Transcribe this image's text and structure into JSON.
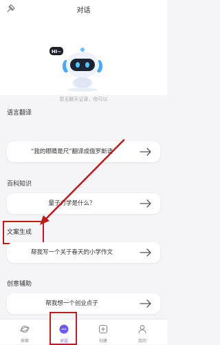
{
  "header": {
    "title": "对话"
  },
  "hero": {
    "badge": "HI~",
    "empty_text": "暂无聊天记录，你可以"
  },
  "sections": [
    {
      "label": "语言翻译",
      "prompt": "“我的眼睛是尺”翻译成俄罗斯语"
    },
    {
      "label": "百科知识",
      "prompt": "量子力学是什么？"
    },
    {
      "label": "文案生成",
      "prompt": "帮我写一个关于春天的小学作文"
    },
    {
      "label": "创意辅助",
      "prompt": "帮我想一个创业点子"
    }
  ],
  "tabs": [
    {
      "label": "探索",
      "icon": "planet-icon"
    },
    {
      "label": "对话",
      "icon": "chat-bubble-icon"
    },
    {
      "label": "创建",
      "icon": "plus-square-icon"
    },
    {
      "label": "我的",
      "icon": "person-icon"
    }
  ],
  "colors": {
    "accent": "#6b5cf6",
    "highlight": "#c0191b",
    "background": "#f5f5f7"
  }
}
